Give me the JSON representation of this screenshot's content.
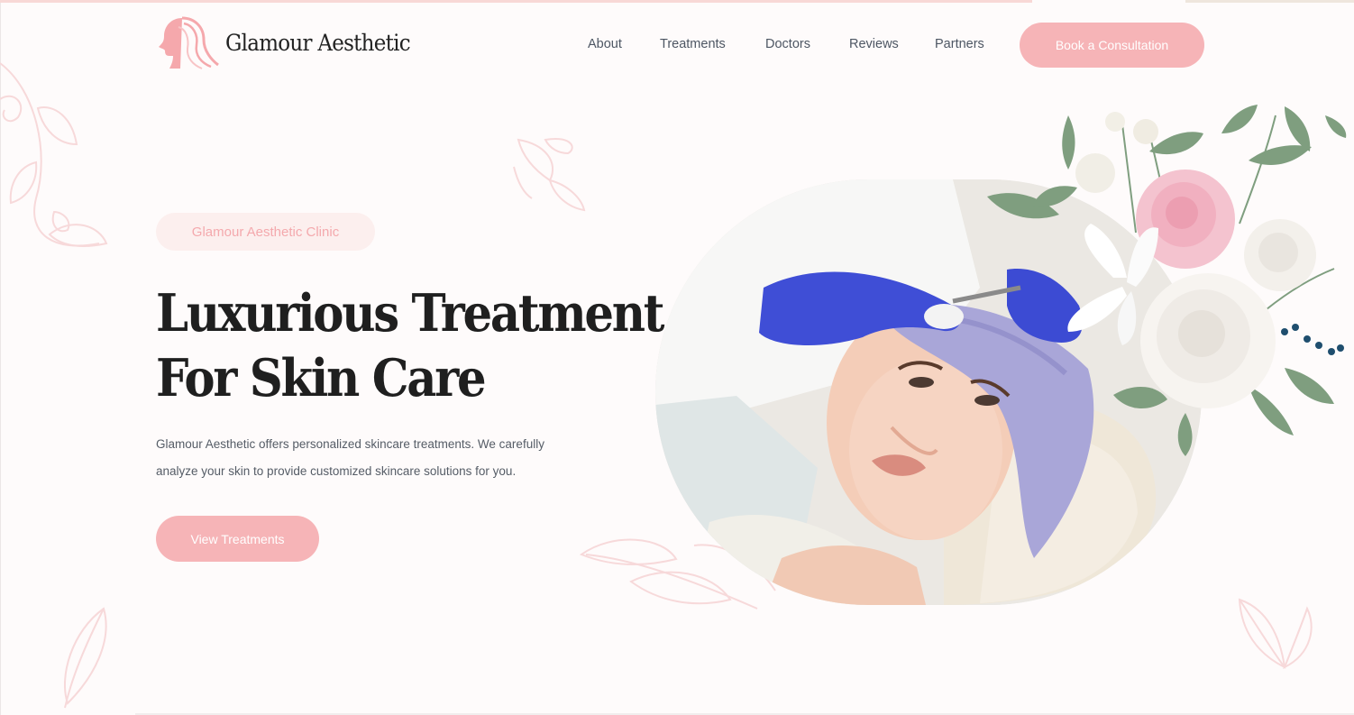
{
  "brand": {
    "name": "Glamour Aesthetic",
    "logo_icon": "woman-profile-icon",
    "accent": "#f6b4b7"
  },
  "nav": {
    "items": [
      {
        "label": "About"
      },
      {
        "label": "Treatments"
      },
      {
        "label": "Doctors"
      },
      {
        "label": "Reviews"
      },
      {
        "label": "Partners"
      }
    ],
    "cta_label": "Book a Consultation"
  },
  "hero": {
    "badge": "Glamour Aesthetic Clinic",
    "title_line1": "Luxurious Treatment",
    "title_line2": "For Skin Care",
    "description_line1": "Glamour Aesthetic offers personalized skincare treatments. We carefully",
    "description_line2": "analyze your skin to provide customized skincare solutions for you.",
    "cta_label": "View Treatments",
    "image": "woman-receiving-facial-injection-photo",
    "flowers": "floral-bouquet-decoration"
  }
}
